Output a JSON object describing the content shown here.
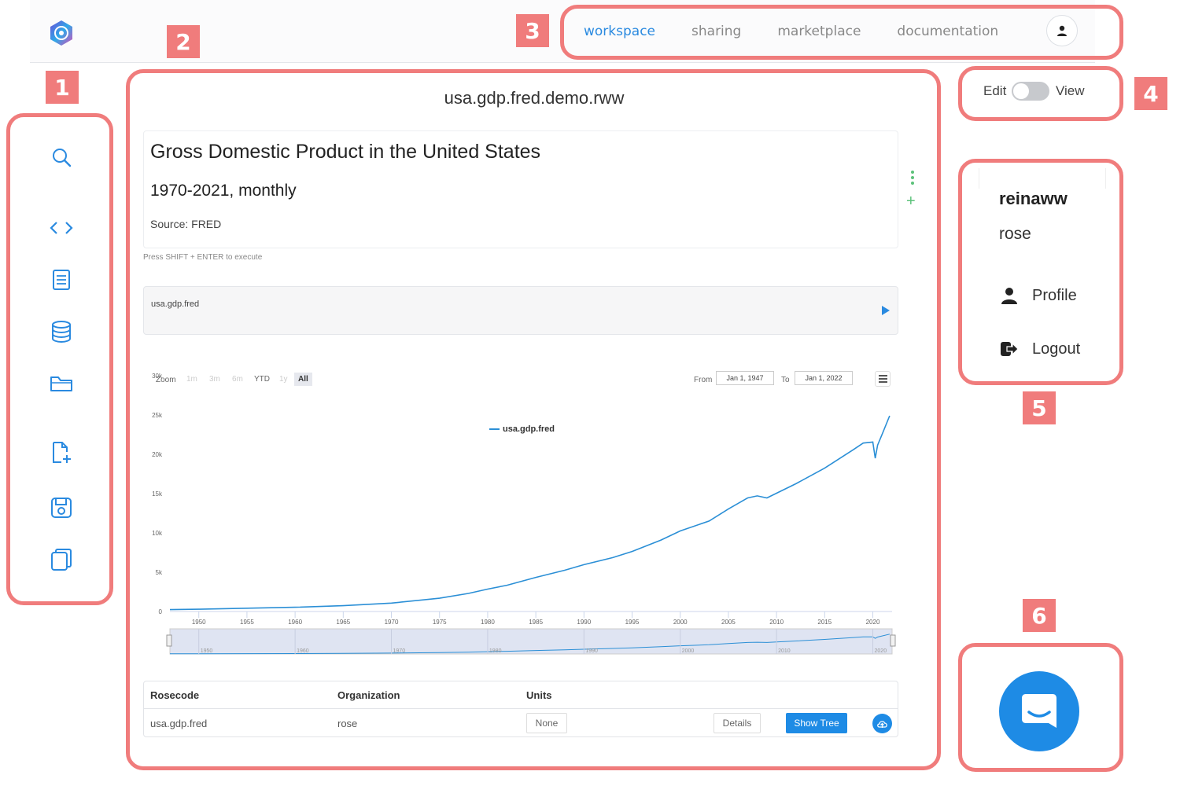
{
  "nav": {
    "items": [
      {
        "label": "workspace",
        "active": true
      },
      {
        "label": "sharing",
        "active": false
      },
      {
        "label": "marketplace",
        "active": false
      },
      {
        "label": "documentation",
        "active": false
      }
    ]
  },
  "sidebar": {
    "icons": [
      "search-icon",
      "code-icon",
      "document-icon",
      "database-icon",
      "folder-icon",
      "new-file-icon",
      "save-icon",
      "copy-icon"
    ]
  },
  "main": {
    "file_title": "usa.gdp.fred.demo.rww",
    "markdown": {
      "h1": "Gross Domestic Product in the United States",
      "h2": "1970-2021, monthly",
      "source": "Source: FRED"
    },
    "hint": "Press SHIFT + ENTER to execute",
    "code": "usa.gdp.fred",
    "chart_toolbar": {
      "zoom_label": "Zoom",
      "zoom_buttons": [
        "1m",
        "3m",
        "6m",
        "YTD",
        "1y",
        "All"
      ],
      "selected": "All",
      "from_label": "From",
      "from_value": "Jan 1, 1947",
      "to_label": "To",
      "to_value": "Jan 1, 2022"
    },
    "table": {
      "headers": {
        "rosecode": "Rosecode",
        "organization": "Organization",
        "units": "Units"
      },
      "row": {
        "rosecode": "usa.gdp.fred",
        "organization": "rose",
        "units": "None"
      },
      "details_label": "Details",
      "show_tree_label": "Show Tree"
    }
  },
  "chart_data": {
    "type": "line",
    "title": "",
    "xlabel": "",
    "ylabel": "",
    "legend": "top-center",
    "grid": false,
    "xlim": [
      1947,
      2022
    ],
    "ylim": [
      0,
      30000
    ],
    "x_ticks": [
      "1950",
      "1955",
      "1960",
      "1965",
      "1970",
      "1975",
      "1980",
      "1985",
      "1990",
      "1995",
      "2000",
      "2005",
      "2010",
      "2015",
      "2020"
    ],
    "y_ticks": [
      "0",
      "5k",
      "10k",
      "15k",
      "20k",
      "25k",
      "30k"
    ],
    "navigator_ticks": [
      "1950",
      "1960",
      "1970",
      "1980",
      "1990",
      "2000",
      "2010",
      "2020"
    ],
    "series": [
      {
        "name": "usa.gdp.fred",
        "color": "#2b8fd6",
        "x": [
          1947,
          1950,
          1955,
          1960,
          1965,
          1970,
          1975,
          1978,
          1980,
          1982,
          1985,
          1988,
          1990,
          1993,
          1995,
          1998,
          2000,
          2003,
          2005,
          2007,
          2008,
          2009,
          2010,
          2012,
          2015,
          2018,
          2019,
          2020.0,
          2020.25,
          2020.5,
          2021.0,
          2021.75
        ],
        "values": [
          240,
          290,
          420,
          540,
          740,
          1070,
          1690,
          2300,
          2850,
          3340,
          4340,
          5250,
          5960,
          6860,
          7640,
          9090,
          10250,
          11510,
          13040,
          14450,
          14710,
          14450,
          15050,
          16250,
          18240,
          20610,
          21430,
          21560,
          19500,
          21170,
          22660,
          24900
        ]
      }
    ]
  },
  "user_menu": {
    "username": "reinaww",
    "org": "rose",
    "profile_label": "Profile",
    "logout_label": "Logout"
  },
  "toggle": {
    "left_label": "Edit",
    "right_label": "View",
    "mode": "Edit"
  },
  "annotations": [
    "1",
    "2",
    "3",
    "4",
    "5",
    "6"
  ],
  "colors": {
    "accent": "#1e8be5",
    "highlight": "#f07c7c",
    "line": "#2b8fd6"
  }
}
